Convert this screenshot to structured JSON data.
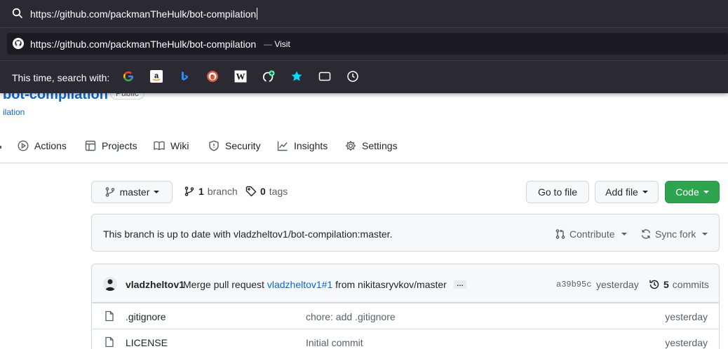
{
  "browser": {
    "url_input": "https://github.com/packmanTheHulk/bot-compilation",
    "suggestion": {
      "url": "https://github.com/packmanTheHulk/bot-compilation",
      "separator": "—",
      "action": "Visit"
    },
    "search_with_label": "This time, search with:",
    "engines": [
      {
        "name": "google-icon"
      },
      {
        "name": "amazon-icon"
      },
      {
        "name": "bing-icon"
      },
      {
        "name": "duckduckgo-icon"
      },
      {
        "name": "wikipedia-icon"
      },
      {
        "name": "github-add-icon"
      },
      {
        "name": "bookmarks-star-icon"
      },
      {
        "name": "tabs-icon"
      },
      {
        "name": "history-clock-icon"
      }
    ]
  },
  "repo": {
    "name": "bot-compilation",
    "visibility": "Public",
    "forked_from": "ilation"
  },
  "tabs": [
    {
      "label": "Actions",
      "icon": "play-icon"
    },
    {
      "label": "Projects",
      "icon": "table-icon"
    },
    {
      "label": "Wiki",
      "icon": "book-icon"
    },
    {
      "label": "Security",
      "icon": "shield-icon"
    },
    {
      "label": "Insights",
      "icon": "graph-icon"
    },
    {
      "label": "Settings",
      "icon": "gear-icon"
    }
  ],
  "toolbar": {
    "branch": "master",
    "branch_count": "1",
    "branch_label": "branch",
    "tag_count": "0",
    "tag_label": "tags",
    "goto_file": "Go to file",
    "add_file": "Add file",
    "code": "Code"
  },
  "notice": {
    "text": "This branch is up to date with vladzheltov1/bot-compilation:master.",
    "contribute": "Contribute",
    "sync_fork": "Sync fork"
  },
  "latest_commit": {
    "author": "vladzheltov1",
    "message_prefix": "Merge pull request",
    "pr_link": "vladzheltov1#1",
    "message_suffix": "from nikitasryvkov/master",
    "ellipsis": "…",
    "sha": "a39b95c",
    "time": "yesterday",
    "commits_count": "5",
    "commits_label": "commits"
  },
  "files": [
    {
      "name": ".gitignore",
      "message": "chore: add .gitignore",
      "time": "yesterday"
    },
    {
      "name": "LICENSE",
      "message": "Initial commit",
      "time": "yesterday"
    }
  ],
  "colors": {
    "code_button": "#2da44e",
    "link": "#0969da",
    "urlbar_bg": "#2b2a33"
  }
}
